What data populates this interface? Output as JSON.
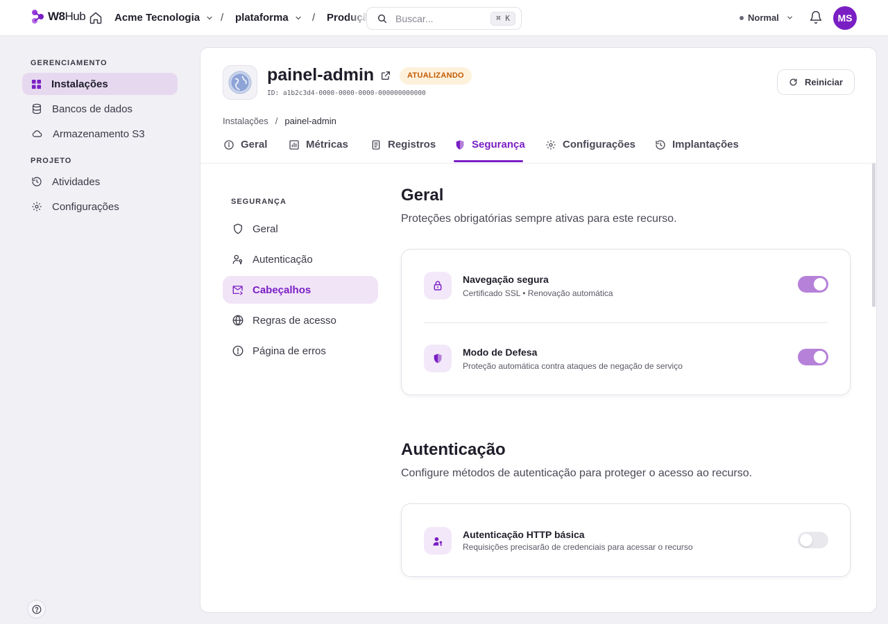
{
  "topbar": {
    "logo_w8": "W8",
    "logo_hub": "Hub",
    "org": "Acme Tecnologia",
    "sep1": "/",
    "project": "plataforma",
    "sep2": "/",
    "env": "Produção",
    "search_placeholder": "Buscar...",
    "search_shortcut": "⌘ K",
    "mode": "Normal",
    "avatar_initials": "MS"
  },
  "sidebar": {
    "section1": "GERENCIAMENTO",
    "section2": "PROJETO",
    "items": [
      {
        "label": "Instalações"
      },
      {
        "label": "Bancos de dados"
      },
      {
        "label": "Armazenamento S3"
      },
      {
        "label": "Atividades"
      },
      {
        "label": "Configurações"
      }
    ]
  },
  "resource": {
    "name": "painel-admin",
    "status": "ATUALIZANDO",
    "id": "ID: a1b2c3d4-0000-0000-0000-000000000000",
    "restart_label": "Reiniciar",
    "breadcrumb": [
      "Instalações",
      "/",
      "painel-admin"
    ]
  },
  "tabs": [
    {
      "label": "Geral"
    },
    {
      "label": "Métricas"
    },
    {
      "label": "Registros"
    },
    {
      "label": "Segurança"
    },
    {
      "label": "Configurações"
    },
    {
      "label": "Implantações"
    }
  ],
  "security_nav": {
    "heading": "SEGURANÇA",
    "items": [
      {
        "label": "Geral"
      },
      {
        "label": "Autenticação"
      },
      {
        "label": "Cabeçalhos"
      },
      {
        "label": "Regras de acesso"
      },
      {
        "label": "Página de erros"
      }
    ]
  },
  "sections": {
    "general": {
      "title": "Geral",
      "description": "Proteções obrigatórias sempre ativas para este recurso.",
      "rows": [
        {
          "title": "Navegação segura",
          "subtitle": "Certificado SSL • Renovação automática",
          "enabled": true
        },
        {
          "title": "Modo de Defesa",
          "subtitle": "Proteção automática contra ataques de negação de serviço",
          "enabled": true
        }
      ]
    },
    "auth": {
      "title": "Autenticação",
      "description": "Configure métodos de autenticação para proteger o acesso ao recurso.",
      "rows": [
        {
          "title": "Autenticação HTTP básica",
          "subtitle": "Requisições precisarão de credenciais para acessar o recurso",
          "enabled": false
        }
      ]
    }
  },
  "colors": {
    "accent": "#7a1fc4",
    "toggle_on": "#b681d9",
    "badge_text": "#c25a00",
    "badge_bg": "#fdf1dc"
  },
  "icons": [
    "w8hub-logo",
    "home-icon",
    "chevron-down-icon",
    "search-icon",
    "bell-icon",
    "grid-icon",
    "database-icon",
    "cloud-icon",
    "history-icon",
    "gear-icon",
    "help-icon",
    "globe-icon",
    "external-link-icon",
    "refresh-icon",
    "info-icon",
    "chart-icon",
    "document-icon",
    "shield-icon",
    "user-key-icon",
    "mail-icon",
    "alert-circle-icon",
    "lock-icon"
  ]
}
